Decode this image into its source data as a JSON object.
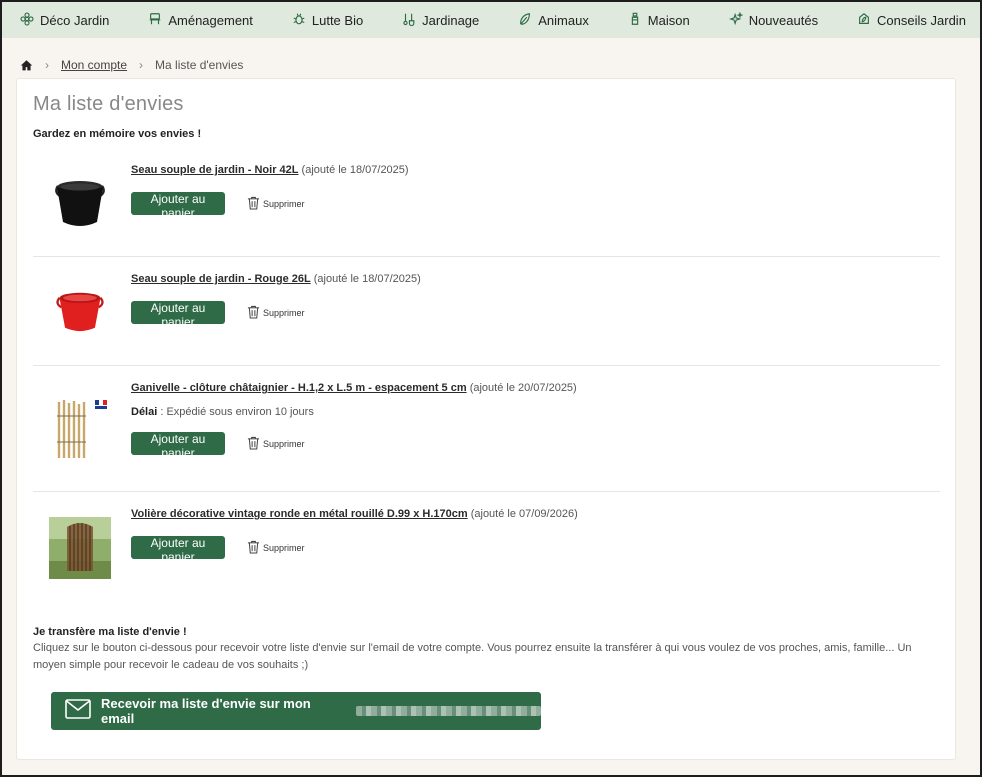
{
  "nav": [
    {
      "label": "Déco Jardin",
      "icon": "flower-icon"
    },
    {
      "label": "Aménagement",
      "icon": "bench-icon"
    },
    {
      "label": "Lutte Bio",
      "icon": "bug-icon"
    },
    {
      "label": "Jardinage",
      "icon": "tools-icon"
    },
    {
      "label": "Animaux",
      "icon": "feather-icon"
    },
    {
      "label": "Maison",
      "icon": "bottle-icon"
    },
    {
      "label": "Nouveautés",
      "icon": "sparkle-icon"
    },
    {
      "label": "Conseils Jardin",
      "icon": "leaf-tag-icon"
    }
  ],
  "breadcrumb": {
    "account": "Mon compte",
    "current": "Ma liste d'envies"
  },
  "page": {
    "title": "Ma liste d'envies",
    "subtitle": "Gardez en mémoire vos envies !"
  },
  "items": [
    {
      "name": "Seau souple de jardin - Noir 42L",
      "added": "(ajouté le 18/07/2025)",
      "delay_label": "",
      "delay": "",
      "thumb": "black-bucket",
      "cart": "Ajouter au panier",
      "delete": "Supprimer"
    },
    {
      "name": "Seau souple de jardin - Rouge 26L",
      "added": "(ajouté le 18/07/2025)",
      "delay_label": "",
      "delay": "",
      "thumb": "red-bucket",
      "cart": "Ajouter au panier",
      "delete": "Supprimer"
    },
    {
      "name": "Ganivelle - clôture châtaignier - H.1,2 x L.5 m - espacement 5 cm",
      "added": "(ajouté le 20/07/2025)",
      "delay_label": "Délai",
      "delay": " : Expédié sous environ 10 jours",
      "thumb": "fence",
      "cart": "Ajouter au panier",
      "delete": "Supprimer"
    },
    {
      "name": "Volière décorative vintage ronde en métal rouillé D.99 x H.170cm",
      "added": "(ajouté le 07/09/2026)",
      "delay_label": "",
      "delay": "",
      "thumb": "aviary",
      "cart": "Ajouter au panier",
      "delete": "Supprimer"
    }
  ],
  "transfer": {
    "title": "Je transfère ma liste d'envie !",
    "text": "Cliquez sur le bouton ci-dessous pour recevoir votre liste d'envie sur l'email de votre compte. Vous pourrez ensuite la transférer à qui vous voulez de vos proches, amis, famille... Un moyen simple pour recevoir le cadeau de vos souhaits ;)",
    "button": "Recevoir ma liste d'envie sur mon email"
  },
  "colors": {
    "nav_bg": "#dfe9dd",
    "accent": "#2f6b47",
    "page_bg": "#f8f4ef"
  }
}
